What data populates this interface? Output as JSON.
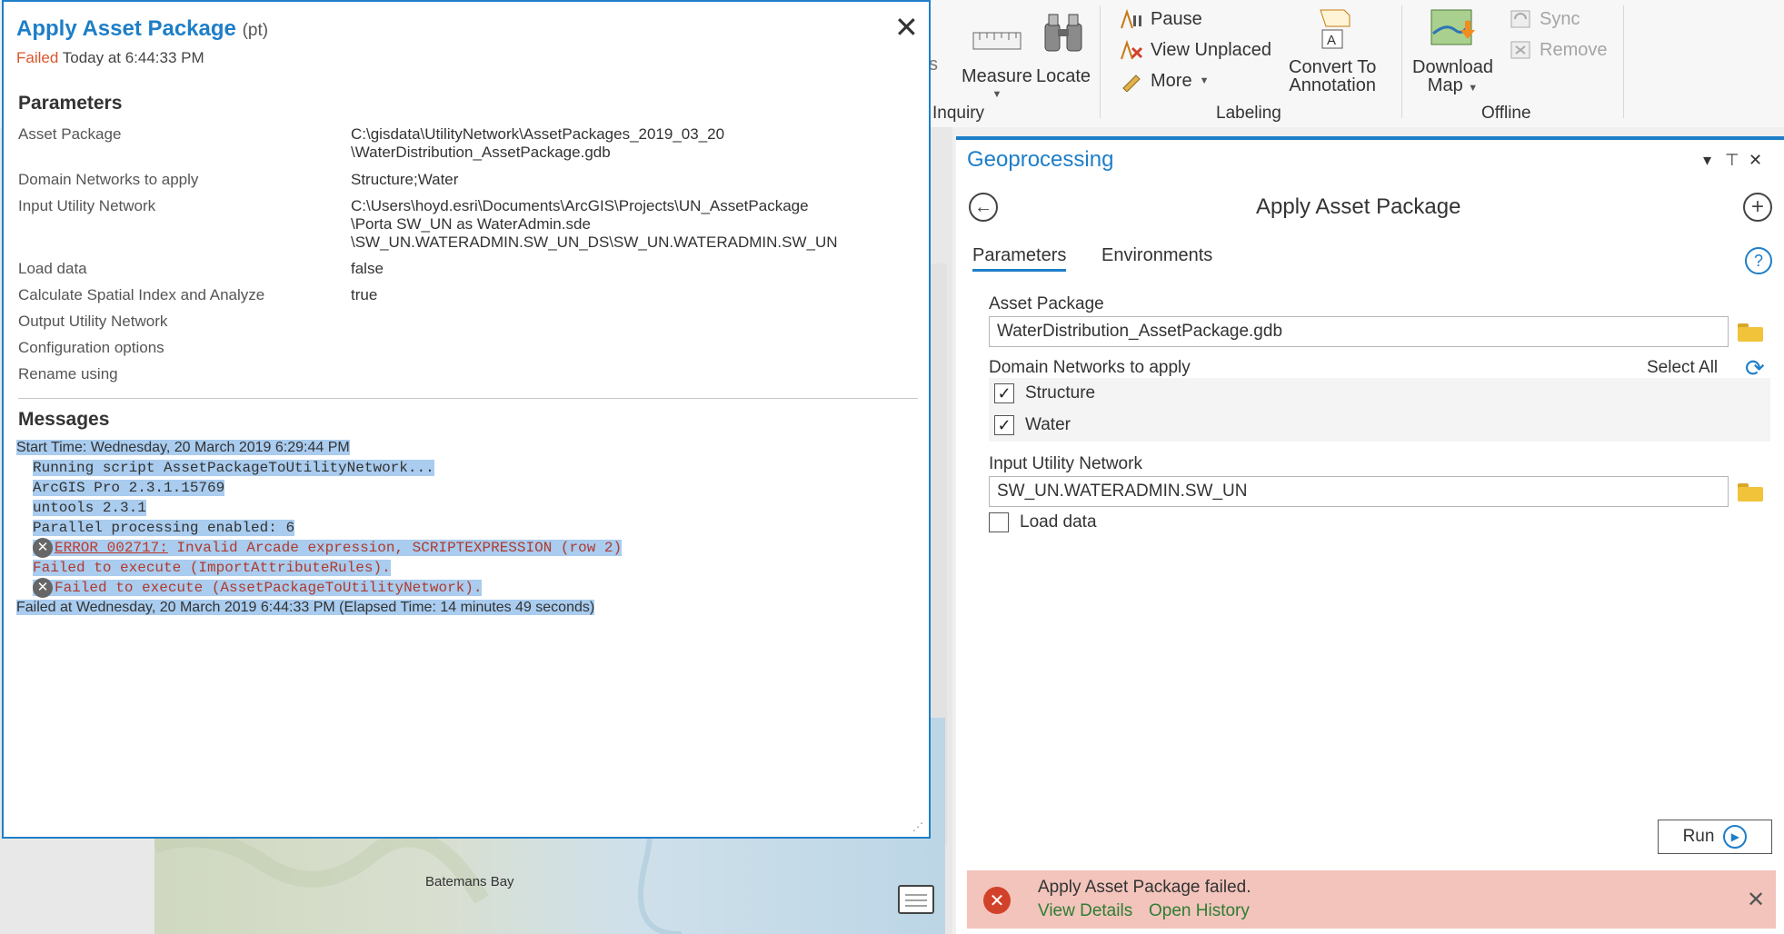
{
  "ribbon": {
    "clipped_left": "s",
    "measure": "Measure",
    "locate": "Locate",
    "pause": "Pause",
    "view_unplaced": "View Unplaced",
    "more": "More",
    "convert_line1": "Convert To",
    "convert_line2": "Annotation",
    "download_line1": "Download",
    "download_line2": "Map",
    "sync": "Sync",
    "remove": "Remove",
    "groups": {
      "inquiry": "Inquiry",
      "labeling": "Labeling",
      "offline": "Offline"
    }
  },
  "map": {
    "place_label": "Batemans Bay"
  },
  "details": {
    "title": "Apply Asset Package",
    "title_suffix": "(pt)",
    "status": "Failed",
    "status_time": "Today at 6:44:33 PM",
    "parameters_heading": "Parameters",
    "parameters": [
      {
        "name": "Asset Package",
        "value": "C:\\gisdata\\UtilityNetwork\\AssetPackages_2019_03_20\n\\WaterDistribution_AssetPackage.gdb"
      },
      {
        "name": "Domain Networks to apply",
        "value": "Structure;Water"
      },
      {
        "name": "Input Utility Network",
        "value": "C:\\Users\\hoyd.esri\\Documents\\ArcGIS\\Projects\\UN_AssetPackage\n\\Porta SW_UN as WaterAdmin.sde\n\\SW_UN.WATERADMIN.SW_UN_DS\\SW_UN.WATERADMIN.SW_UN"
      },
      {
        "name": "Load data",
        "value": "false"
      },
      {
        "name": "Calculate Spatial Index and Analyze",
        "value": "true"
      },
      {
        "name": "Output Utility Network",
        "value": ""
      },
      {
        "name": "Configuration options",
        "value": ""
      },
      {
        "name": "Rename using",
        "value": ""
      }
    ],
    "messages_heading": "Messages",
    "messages": {
      "start": "Start Time: Wednesday, 20 March 2019 6:29:44 PM",
      "running": "Running script AssetPackageToUtilityNetwork...",
      "arcgis": "ArcGIS Pro 2.3.1.15769",
      "untools": "untools 2.3.1",
      "parallel": "Parallel processing enabled: 6",
      "error_code": "ERROR 002717:",
      "error_text": " Invalid Arcade expression, SCRIPTEXPRESSION (row 2)",
      "failed_import": "Failed to execute (ImportAttributeRules).",
      "failed_apt": "Failed to execute (AssetPackageToUtilityNetwork).",
      "end": "Failed at Wednesday, 20 March 2019 6:44:33 PM (Elapsed Time: 14 minutes 49 seconds)"
    }
  },
  "gp": {
    "title": "Geoprocessing",
    "tool_title": "Apply Asset Package",
    "tabs": [
      "Parameters",
      "Environments"
    ],
    "asset_package_label": "Asset Package",
    "asset_package_value": "WaterDistribution_AssetPackage.gdb",
    "domain_label": "Domain Networks to apply",
    "select_all": "Select All",
    "domains": [
      {
        "label": "Structure",
        "checked": "✓"
      },
      {
        "label": "Water",
        "checked": "✓"
      }
    ],
    "input_un_label": "Input Utility Network",
    "input_un_value": "SW_UN.WATERADMIN.SW_UN",
    "load_data_label": "Load data",
    "run": "Run",
    "fail_message": "Apply Asset Package failed.",
    "view_details": "View Details",
    "open_history": "Open History"
  }
}
